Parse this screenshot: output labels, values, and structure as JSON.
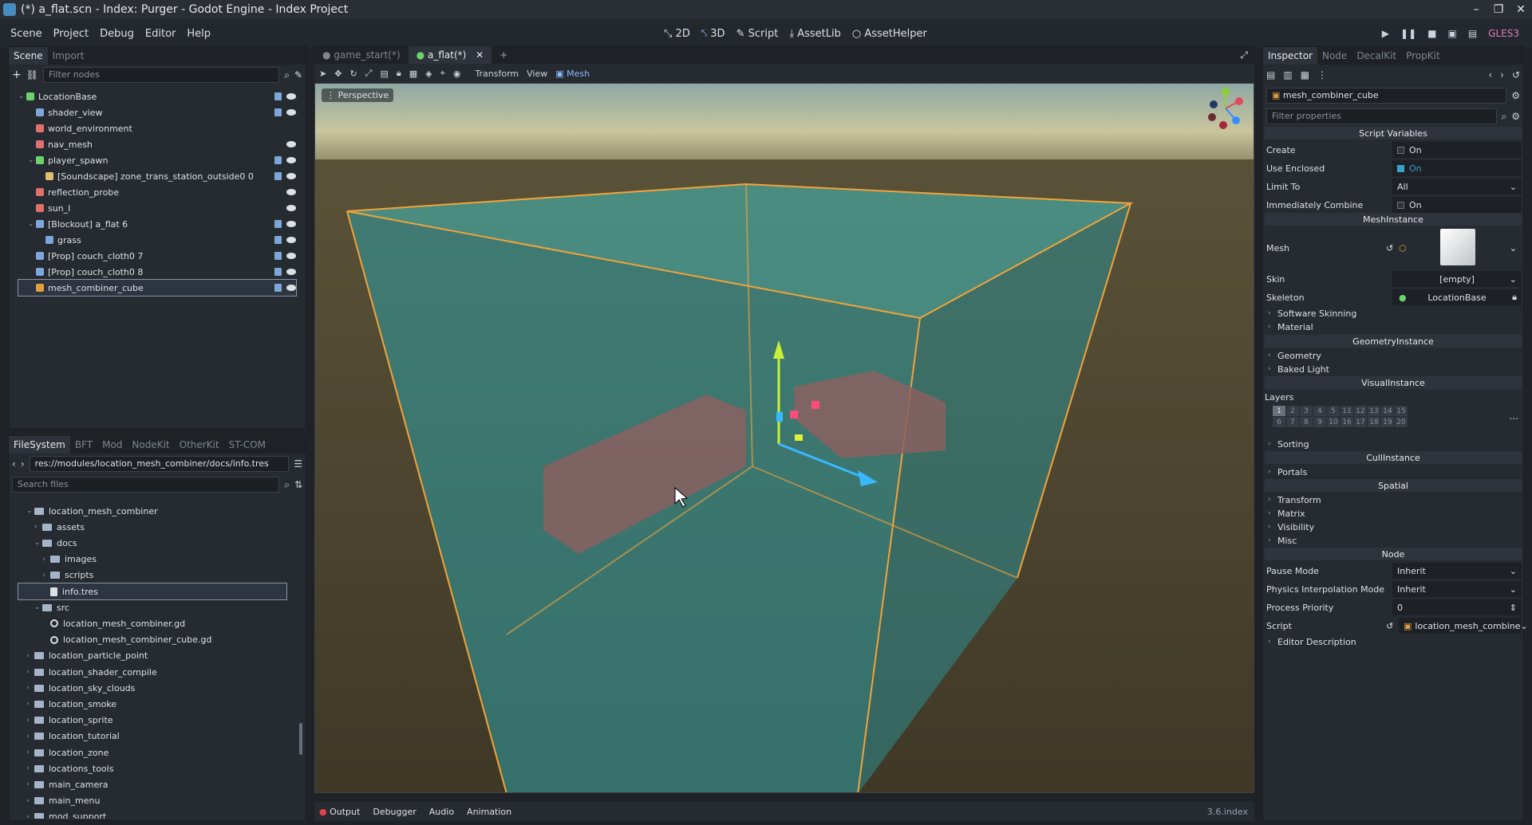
{
  "window": {
    "title": "(*) a_flat.scn - Index: Purger - Godot Engine - Index Project",
    "controls": [
      "–",
      "❐",
      "✕"
    ]
  },
  "menubar": [
    "Scene",
    "Project",
    "Debug",
    "Editor",
    "Help"
  ],
  "workspaces": [
    "2D",
    "3D",
    "Script",
    "AssetLib",
    "AssetHelper"
  ],
  "renderer": "GLES3",
  "scene_dock": {
    "tabs": [
      "Scene",
      "Import"
    ],
    "filter_placeholder": "Filter nodes",
    "nodes": [
      {
        "label": "LocationBase",
        "indent": 0,
        "expanded": true,
        "color": "#6cd36c"
      },
      {
        "label": "shader_view",
        "indent": 1,
        "color": "#7ca7d8"
      },
      {
        "label": "world_environment",
        "indent": 1,
        "color": "#e07070"
      },
      {
        "label": "nav_mesh",
        "indent": 1,
        "color": "#e07070"
      },
      {
        "label": "player_spawn",
        "indent": 1,
        "expanded": true,
        "color": "#6cd36c"
      },
      {
        "label": "[Soundscape] zone_trans_station_outside0 0",
        "indent": 2,
        "color": "#e0c070"
      },
      {
        "label": "reflection_probe",
        "indent": 1,
        "color": "#e07070"
      },
      {
        "label": "sun_l",
        "indent": 1,
        "color": "#e07070"
      },
      {
        "label": "[Blockout] a_flat 6",
        "indent": 1,
        "expanded": true,
        "color": "#7ca7d8"
      },
      {
        "label": "grass",
        "indent": 2,
        "color": "#7ca7d8"
      },
      {
        "label": "[Prop] couch_cloth0 7",
        "indent": 1,
        "color": "#7ca7d8"
      },
      {
        "label": "[Prop] couch_cloth0 8",
        "indent": 1,
        "color": "#7ca7d8"
      },
      {
        "label": "mesh_combiner_cube",
        "indent": 1,
        "color": "#e0a040",
        "selected": true
      }
    ]
  },
  "filesystem_dock": {
    "tabs": [
      "FileSystem",
      "BFT",
      "Mod",
      "NodeKit",
      "OtherKit",
      "ST-COM"
    ],
    "path": "res://modules/location_mesh_combiner/docs/info.tres",
    "search_placeholder": "Search files",
    "items": [
      {
        "label": "location_mesh_combiner",
        "indent": 1,
        "kind": "folder",
        "expanded": true
      },
      {
        "label": "assets",
        "indent": 2,
        "kind": "folder"
      },
      {
        "label": "docs",
        "indent": 2,
        "kind": "folder",
        "expanded": true
      },
      {
        "label": "images",
        "indent": 3,
        "kind": "folder"
      },
      {
        "label": "scripts",
        "indent": 3,
        "kind": "folder"
      },
      {
        "label": "info.tres",
        "indent": 3,
        "kind": "file",
        "selected": true
      },
      {
        "label": "src",
        "indent": 2,
        "kind": "folder",
        "expanded": true
      },
      {
        "label": "location_mesh_combiner.gd",
        "indent": 3,
        "kind": "gear"
      },
      {
        "label": "location_mesh_combiner_cube.gd",
        "indent": 3,
        "kind": "gear"
      },
      {
        "label": "location_particle_point",
        "indent": 1,
        "kind": "folder"
      },
      {
        "label": "location_shader_compile",
        "indent": 1,
        "kind": "folder"
      },
      {
        "label": "location_sky_clouds",
        "indent": 1,
        "kind": "folder"
      },
      {
        "label": "location_smoke",
        "indent": 1,
        "kind": "folder"
      },
      {
        "label": "location_sprite",
        "indent": 1,
        "kind": "folder"
      },
      {
        "label": "location_tutorial",
        "indent": 1,
        "kind": "folder"
      },
      {
        "label": "location_zone",
        "indent": 1,
        "kind": "folder"
      },
      {
        "label": "locations_tools",
        "indent": 1,
        "kind": "folder"
      },
      {
        "label": "main_camera",
        "indent": 1,
        "kind": "folder"
      },
      {
        "label": "main_menu",
        "indent": 1,
        "kind": "folder"
      },
      {
        "label": "mod_support",
        "indent": 1,
        "kind": "folder"
      }
    ]
  },
  "editor_tabs": [
    {
      "label": "game_start(*)",
      "active": false
    },
    {
      "label": "a_flat(*)",
      "active": true
    }
  ],
  "viewport_toolbar": {
    "transform": "Transform",
    "view": "View",
    "mesh": "Mesh"
  },
  "viewport": {
    "perspective_label": "Perspective"
  },
  "inspector": {
    "tabs": [
      "Inspector",
      "Node",
      "DecalKit",
      "PropKit"
    ],
    "object_name": "mesh_combiner_cube",
    "filter_placeholder": "Filter properties",
    "script_variables_header": "Script Variables",
    "create_label": "Create",
    "create_value": "On",
    "use_enclosed_label": "Use Enclosed",
    "use_enclosed_value": "On",
    "limit_to_label": "Limit To",
    "limit_to_value": "All",
    "immediately_combine_label": "Immediately Combine",
    "immediately_combine_value": "On",
    "meshinstance_header": "MeshInstance",
    "mesh_label": "Mesh",
    "skin_label": "Skin",
    "skin_value": "[empty]",
    "skeleton_label": "Skeleton",
    "skeleton_value": "LocationBase",
    "software_skinning": "Software Skinning",
    "material": "Material",
    "geometryinstance_header": "GeometryInstance",
    "geometry": "Geometry",
    "baked_light": "Baked Light",
    "visualinstance_header": "VisualInstance",
    "layers_label": "Layers",
    "layers": [
      "1",
      "2",
      "3",
      "4",
      "5",
      "11",
      "12",
      "13",
      "14",
      "15",
      "6",
      "7",
      "8",
      "9",
      "10",
      "16",
      "17",
      "18",
      "19",
      "20"
    ],
    "layers_more": "...",
    "sorting": "Sorting",
    "portals": "Portals",
    "cullinstance_header": "CullInstance",
    "spatial_header": "Spatial",
    "transform": "Transform",
    "matrix": "Matrix",
    "visibility": "Visibility",
    "misc": "Misc",
    "node_header": "Node",
    "pause_mode_label": "Pause Mode",
    "pause_mode_value": "Inherit",
    "physics_interp_label": "Physics Interpolation Mode",
    "physics_interp_value": "Inherit",
    "process_priority_label": "Process Priority",
    "process_priority_value": "0",
    "script_label": "Script",
    "script_value": "location_mesh_combine",
    "editor_description": "Editor Description"
  },
  "bottom_panel": {
    "tabs": [
      "Output",
      "Debugger",
      "Audio",
      "Animation"
    ],
    "version": "3.6.index"
  }
}
